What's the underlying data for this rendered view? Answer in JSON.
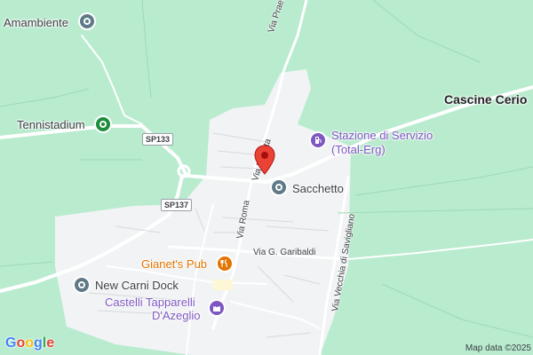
{
  "map": {
    "colors": {
      "land": "#b9ebcf",
      "urban": "#f1f3f4",
      "road": "#ffffff",
      "poi_teal": "#5f7a87",
      "poi_green": "#1e8e3e",
      "poi_purple": "#7e57c2",
      "poi_orange": "#e37400",
      "pin_red": "#ea4335"
    },
    "places": {
      "amambiente": "Amambiente",
      "tennistadium": "Tennistadium",
      "sacchetto": "Sacchetto",
      "stazione_line1": "Stazione di Servizio",
      "stazione_line2": "(Total-Erg)",
      "cascine_cerio": "Cascine Cerio",
      "gianets_pub": "Gianet's Pub",
      "new_carni_dock": "New Carni Dock",
      "castelli_line1": "Castelli Tapparelli",
      "castelli_line2": "D'Azeglio"
    },
    "roads": {
      "via_praetta_north": "Via Praetta",
      "via_praetta_south": "Via Praetta",
      "via_roma": "Via Roma",
      "via_garibaldi": "Via G. Garibaldi",
      "via_vecchia": "Via Vecchia di Savigliano",
      "sp133": "SP133",
      "sp137": "SP137"
    },
    "icons": {
      "generic_poi": "map-marker-circle-icon",
      "sport": "sport-venue-icon",
      "fuel": "fuel-pump-icon",
      "food": "fork-knife-icon",
      "castle": "castle-icon",
      "pin": "red-location-pin-icon"
    },
    "attribution": "Map data ©2025",
    "logo": {
      "letters": [
        "G",
        "o",
        "o",
        "g",
        "l",
        "e"
      ],
      "colors": [
        "#4285f4",
        "#ea4335",
        "#fbbc05",
        "#4285f4",
        "#34a853",
        "#ea4335"
      ]
    }
  }
}
